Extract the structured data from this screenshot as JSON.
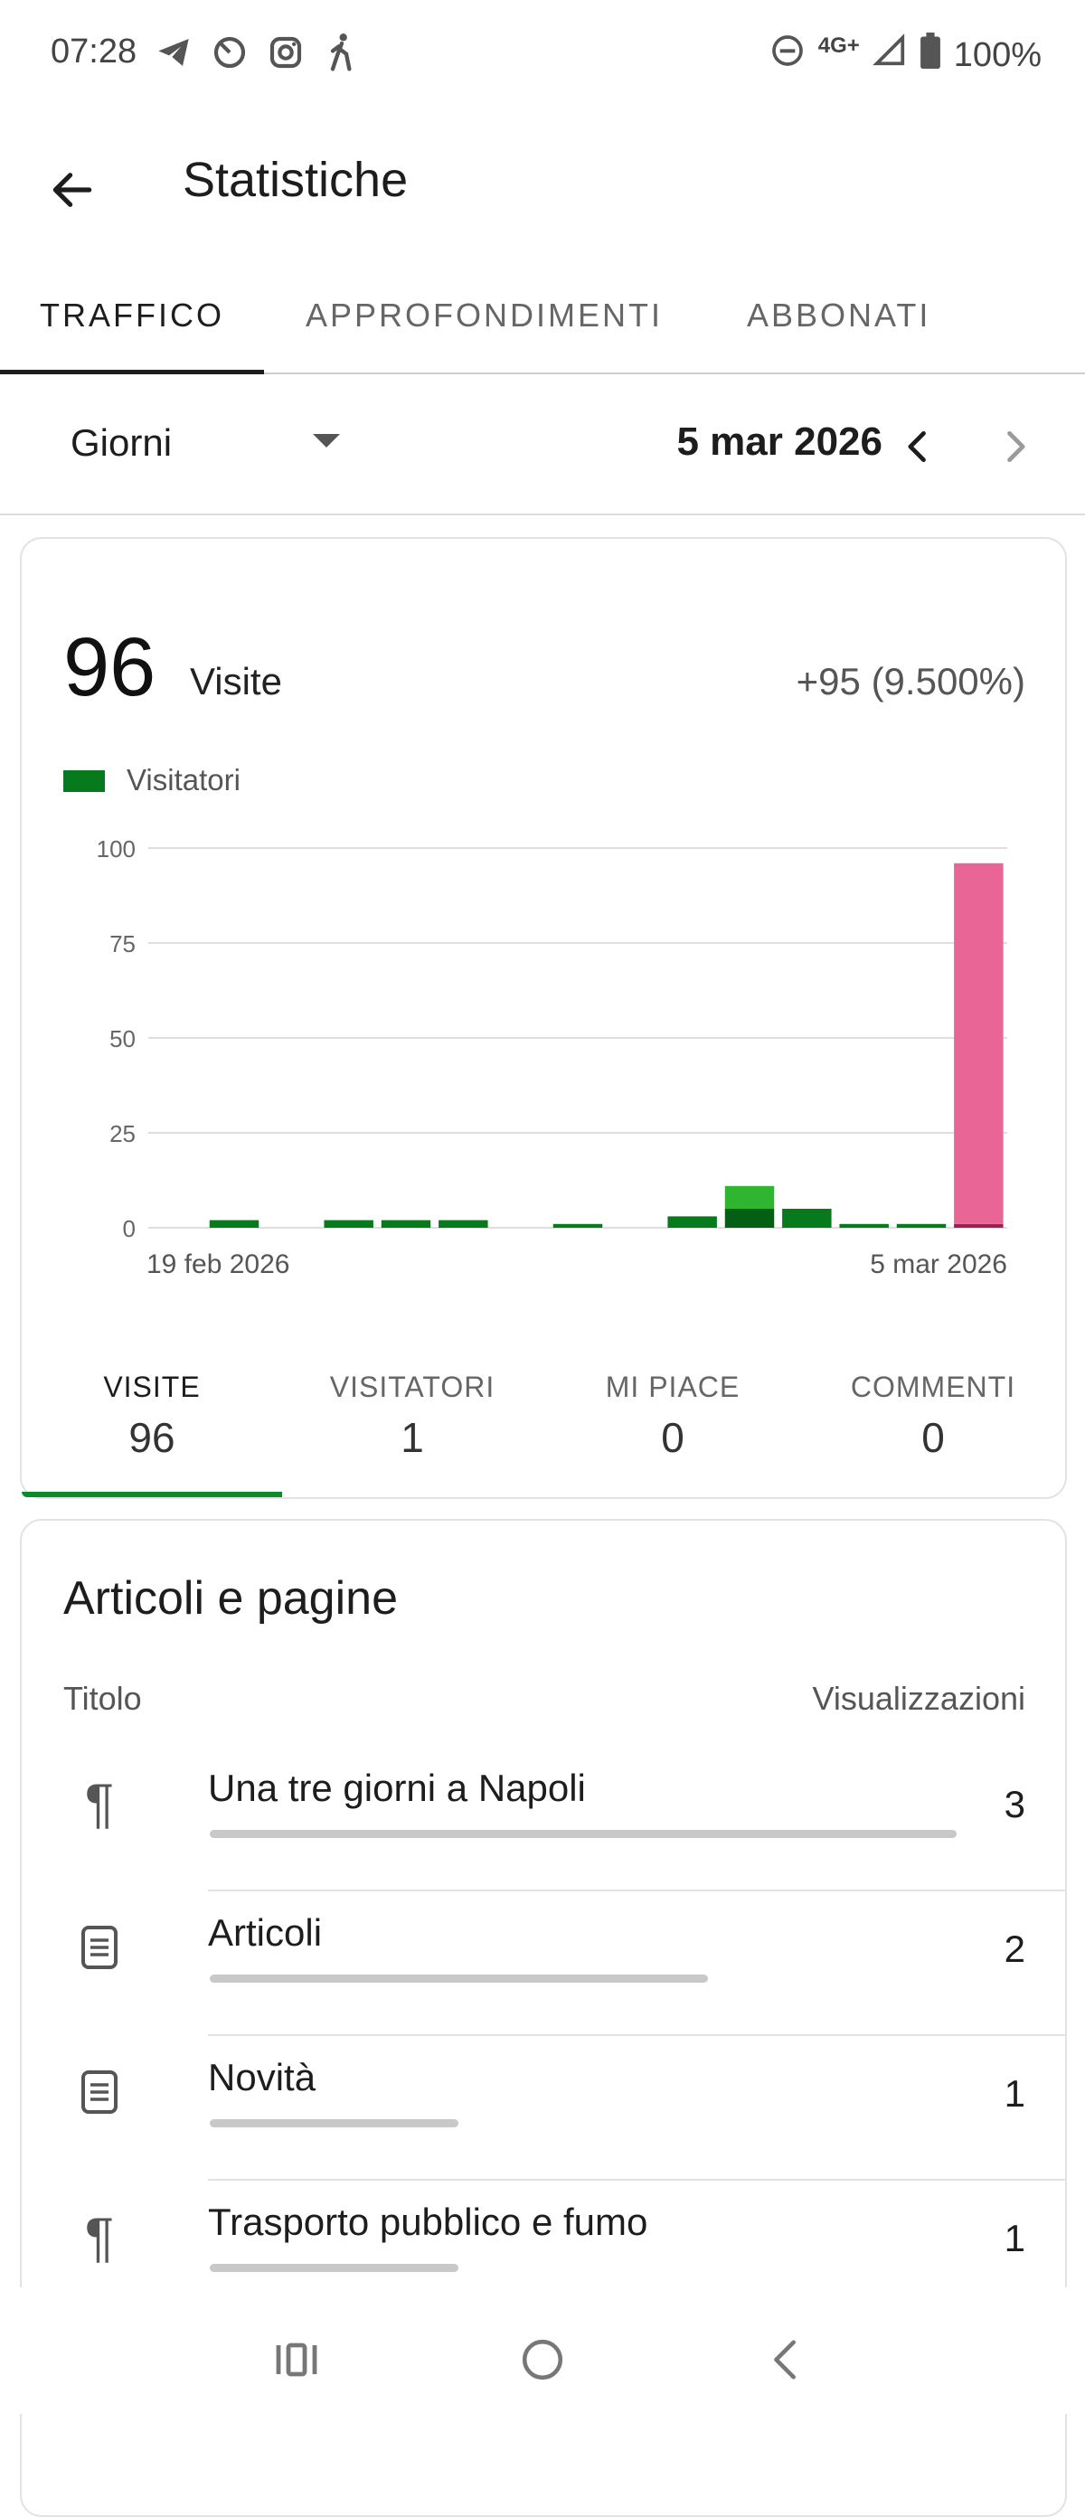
{
  "status_bar": {
    "time": "07:28",
    "network": "4G+",
    "battery": "100%",
    "icons": [
      "telegram-icon",
      "timer-icon",
      "instagram-icon",
      "walk-icon",
      "dnd-icon",
      "signal-icon",
      "battery-icon"
    ]
  },
  "app_bar": {
    "title": "Statistiche",
    "back_icon": "arrow-left-icon"
  },
  "tabs": [
    {
      "label": "TRAFFICO",
      "active": true
    },
    {
      "label": "APPROFONDIMENTI",
      "active": false
    },
    {
      "label": "ABBONATI",
      "active": false
    }
  ],
  "period": {
    "selected": "Giorni",
    "date": "5 mar 2026"
  },
  "summary": {
    "value": "96",
    "label": "Visite",
    "change": "+95 (9.500%)"
  },
  "legend": {
    "label": "Visitatori"
  },
  "colors": {
    "green": "#067a1c",
    "dark_green": "#045f15",
    "light_green": "#2fb52f",
    "pink": "#e96596",
    "accent": "#0e8a2d"
  },
  "chart_data": {
    "type": "bar",
    "ylim": [
      0,
      100
    ],
    "yticks": [
      "0",
      "25",
      "50",
      "75",
      "100"
    ],
    "x_labels": [
      "19 feb 2026",
      "5 mar 2026"
    ],
    "grid": true,
    "series": [
      {
        "name": "Visitatori",
        "values": [
          0,
          2,
          0,
          2,
          2,
          2,
          0,
          1,
          0,
          3,
          5,
          5,
          1,
          1,
          1
        ]
      },
      {
        "values": [
          0,
          0,
          0,
          0,
          0,
          0,
          0,
          0,
          0,
          0,
          6,
          0,
          0,
          0,
          95
        ]
      }
    ]
  },
  "stats": [
    {
      "label": "VISITE",
      "value": "96",
      "active": true
    },
    {
      "label": "VISITATORI",
      "value": "1",
      "active": false
    },
    {
      "label": "MI PIACE",
      "value": "0",
      "active": false
    },
    {
      "label": "COMMENTI",
      "value": "0",
      "active": false
    }
  ],
  "posts": {
    "heading": "Articoli e pagine",
    "col_title": "Titolo",
    "col_views": "Visualizzazioni",
    "rows": [
      {
        "icon": "paragraph-icon",
        "title": "Una tre giorni a Napoli",
        "views": "3",
        "share": 1.0
      },
      {
        "icon": "page-icon",
        "title": "Articoli",
        "views": "2",
        "share": 0.667
      },
      {
        "icon": "page-icon",
        "title": "Novità",
        "views": "1",
        "share": 0.333
      },
      {
        "icon": "paragraph-icon",
        "title": "Trasporto pubblico e fumo",
        "views": "1",
        "share": 0.333
      }
    ]
  }
}
